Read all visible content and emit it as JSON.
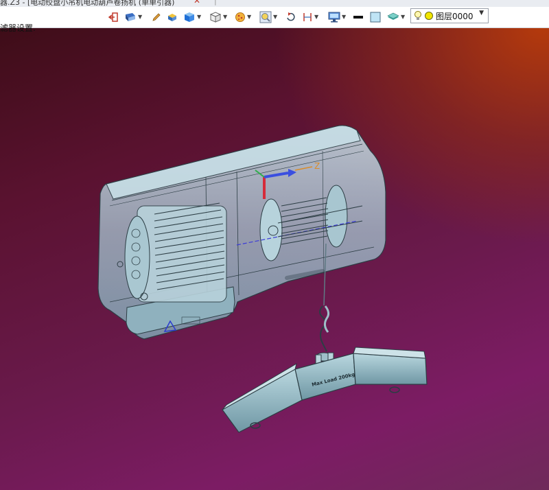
{
  "window": {
    "title": "器.Z3 - [电动绞盘小吊机电动葫芦卷扬机 (单单引器)",
    "close_glyph": "✕",
    "tab_sep": "|"
  },
  "toolbar": {
    "layer_selector": {
      "value": "图层0000",
      "active_color": "#f2e600"
    },
    "icons": [
      "exit-icon",
      "view-display-icon",
      "pencil-icon",
      "box-color-icon",
      "blue-cube-icon",
      "white-cube-icon",
      "pizza-section-icon",
      "zoom-view-icon",
      "rotate-icon",
      "dimension-icon",
      "monitor-icon",
      "line-style-icon",
      "fill-color-icon",
      "layer-stack-icon"
    ]
  },
  "filter_bar": {
    "label": "滤器设置."
  },
  "model": {
    "beam_label": "Max Load 200kg",
    "triad_label": "Z"
  },
  "colors": {
    "accent": "#1f6fd6",
    "model_body": "#9fc6d4",
    "beam": "#8fb9c4"
  }
}
